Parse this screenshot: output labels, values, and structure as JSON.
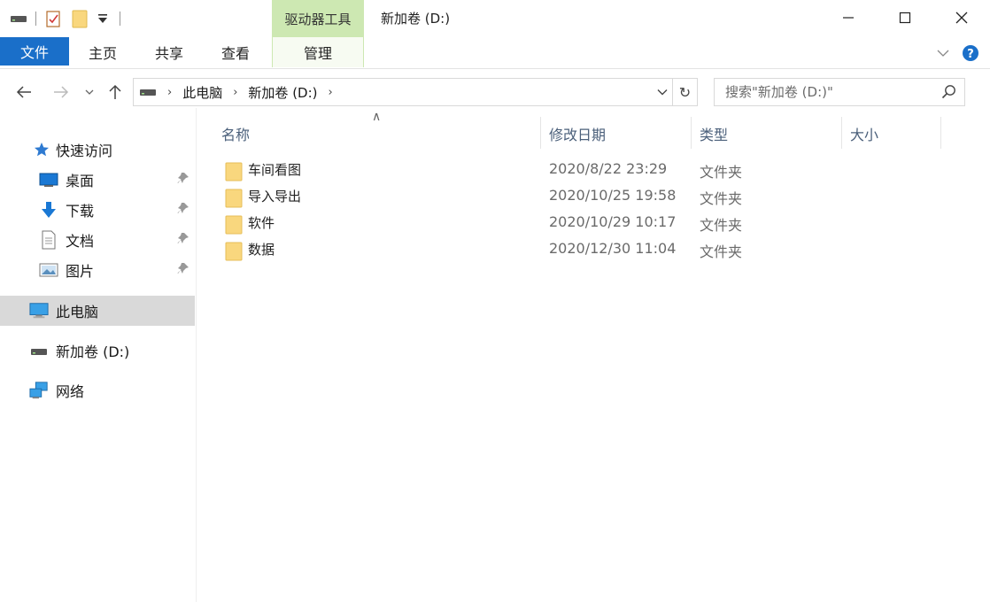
{
  "window": {
    "title": "新加卷 (D:)",
    "context_group": "驱动器工具"
  },
  "ribbon": {
    "tabs": [
      {
        "label": "文件"
      },
      {
        "label": "主页"
      },
      {
        "label": "共享"
      },
      {
        "label": "查看"
      },
      {
        "label": "管理"
      }
    ]
  },
  "address": {
    "crumbs": [
      "此电脑",
      "新加卷 (D:)"
    ]
  },
  "search": {
    "placeholder": "搜索\"新加卷 (D:)\""
  },
  "sidebar": {
    "quick_access": "快速访问",
    "items": [
      {
        "label": "桌面"
      },
      {
        "label": "下载"
      },
      {
        "label": "文档"
      },
      {
        "label": "图片"
      }
    ],
    "this_pc": "此电脑",
    "drive": "新加卷 (D:)",
    "network": "网络"
  },
  "columns": {
    "name": "名称",
    "date": "修改日期",
    "type": "类型",
    "size": "大小"
  },
  "files": [
    {
      "name": "车间看图",
      "date": "2020/8/22 23:29",
      "type": "文件夹"
    },
    {
      "name": "导入导出",
      "date": "2020/10/25 19:58",
      "type": "文件夹"
    },
    {
      "name": "软件",
      "date": "2020/10/29 10:17",
      "type": "文件夹"
    },
    {
      "name": "数据",
      "date": "2020/12/30 11:04",
      "type": "文件夹"
    }
  ],
  "colors": {
    "file_tab": "#1a6fc9",
    "context_tab": "#cde8b2",
    "folder": "#f9d77e",
    "selected_nav": "#d9d9d9"
  }
}
